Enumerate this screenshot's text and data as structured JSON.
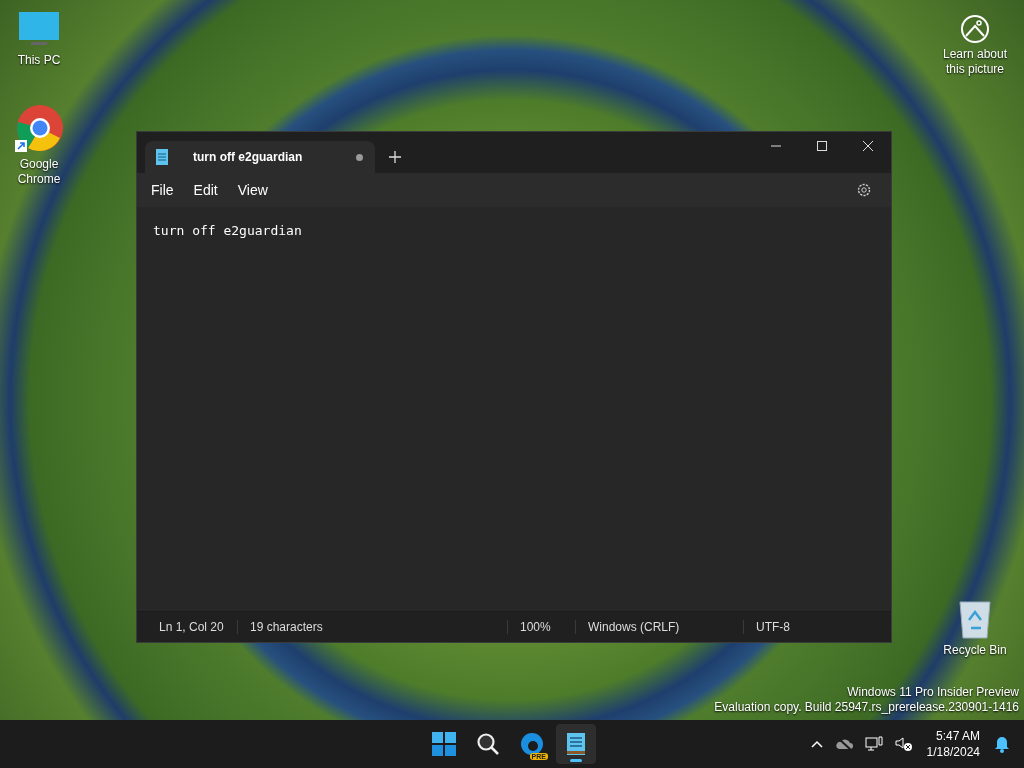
{
  "desktop_icons": [
    {
      "label": "This PC",
      "kind": "monitor"
    },
    {
      "label": "Google Chrome",
      "kind": "browser"
    }
  ],
  "spotlight": {
    "label": "Learn about this picture"
  },
  "recycle_bin": {
    "label": "Recycle Bin"
  },
  "window": {
    "tabs": [
      {
        "title": "turn off e2guardian",
        "selected": true,
        "unsaved": true
      }
    ],
    "menu": [
      "File",
      "Edit",
      "View"
    ],
    "content": "turn off e2guardian",
    "status_bar": [
      "Ln 1, Col 20",
      "19 characters",
      "100%",
      "Windows (CRLF)",
      "UTF-8"
    ]
  },
  "watermark": [
    "Windows 11 Pro Insider Preview",
    "Evaluation copy. Build 25947.rs_prerelease.230901-1416"
  ],
  "taskbar": {
    "apps": [
      {
        "kind": "start",
        "selected": false
      },
      {
        "kind": "search",
        "selected": false
      },
      {
        "kind": "edge",
        "badge": "PRE",
        "selected": false
      },
      {
        "kind": "notepad",
        "selected": true
      }
    ],
    "clock": {
      "time": "5:47 AM",
      "date": "1/18/2024"
    }
  }
}
